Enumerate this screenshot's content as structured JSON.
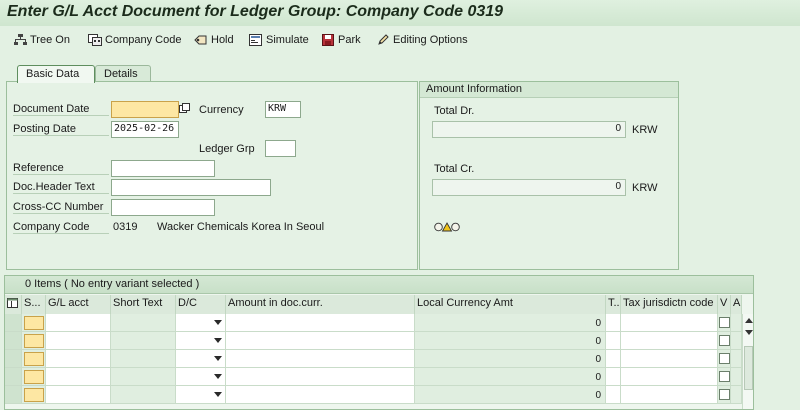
{
  "window": {
    "title": "Enter G/L Acct Document for Ledger Group: Company Code 0319"
  },
  "toolbar": {
    "tree_on": "Tree On",
    "company_code": "Company Code",
    "hold": "Hold",
    "simulate": "Simulate",
    "park": "Park",
    "editing_options": "Editing Options"
  },
  "tabs": {
    "basic_data": "Basic Data",
    "details": "Details"
  },
  "basic": {
    "document_date_label": "Document Date",
    "document_date": "",
    "posting_date_label": "Posting Date",
    "posting_date": "2025-02-26",
    "currency_label": "Currency",
    "currency": "KRW",
    "ledger_grp_label": "Ledger Grp",
    "ledger_grp": "",
    "reference_label": "Reference",
    "reference": "",
    "doc_header_label": "Doc.Header Text",
    "doc_header": "",
    "cross_cc_label": "Cross-CC Number",
    "cross_cc": "",
    "company_code_label": "Company Code",
    "company_code": "0319",
    "company_name": "Wacker Chemicals Korea In Seoul"
  },
  "amount": {
    "header": "Amount Information",
    "total_dr_label": "Total Dr.",
    "total_dr": "0",
    "total_dr_currency": "KRW",
    "total_cr_label": "Total Cr.",
    "total_cr": "0",
    "total_cr_currency": "KRW",
    "status_icon": "traffic-light-icon"
  },
  "table": {
    "title": "0 Items ( No entry variant selected )",
    "columns": {
      "s": "S...",
      "gl_acct": "G/L acct",
      "short_text": "Short Text",
      "dc": "D/C",
      "amount_doc": "Amount in doc.curr.",
      "local_amt": "Local Currency Amt",
      "t": "T...",
      "tax_juris": "Tax jurisdictn code",
      "v": "V",
      "a": "A"
    },
    "rows": [
      {
        "local_amt": "0"
      },
      {
        "local_amt": "0"
      },
      {
        "local_amt": "0"
      },
      {
        "local_amt": "0"
      },
      {
        "local_amt": "0"
      }
    ]
  }
}
